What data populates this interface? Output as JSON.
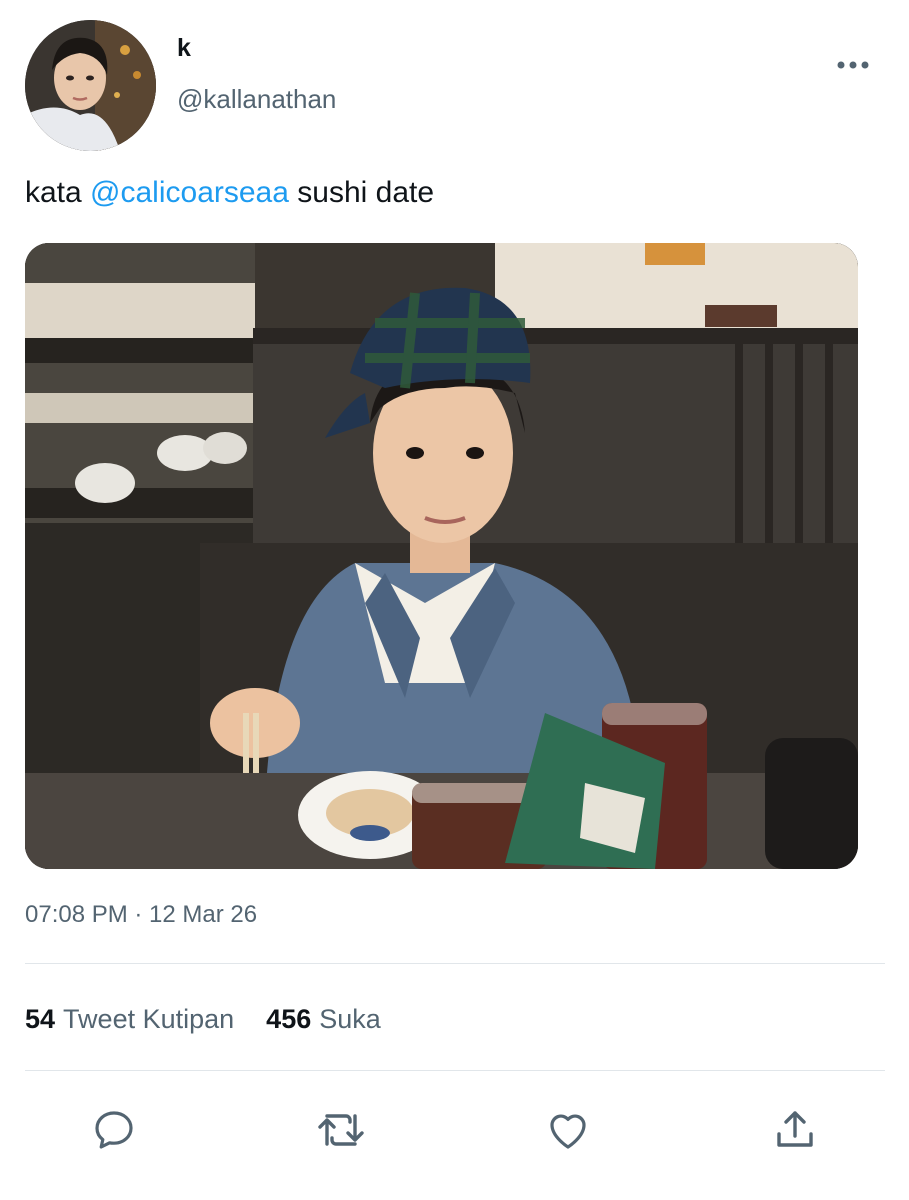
{
  "author": {
    "display_name": "k",
    "handle": "@kallanathan",
    "avatar_icon": "avatar-photo"
  },
  "tweet": {
    "text_before": "kata ",
    "mention": "@calicoarseaa",
    "text_after": " sushi date",
    "media_description_icon": "photo-icon",
    "timestamp": "07:08 PM · 12 Mar 26"
  },
  "stats": {
    "quotes_count": "54",
    "quotes_label": "Tweet Kutipan",
    "likes_count": "456",
    "likes_label": "Suka"
  },
  "actions": {
    "reply_icon": "reply-icon",
    "retweet_icon": "retweet-icon",
    "like_icon": "heart-icon",
    "share_icon": "share-icon"
  },
  "colors": {
    "accent": "#1d9bf0",
    "secondary_text": "#536471",
    "primary_text": "#0f1419",
    "divider": "#e1e6ea"
  }
}
